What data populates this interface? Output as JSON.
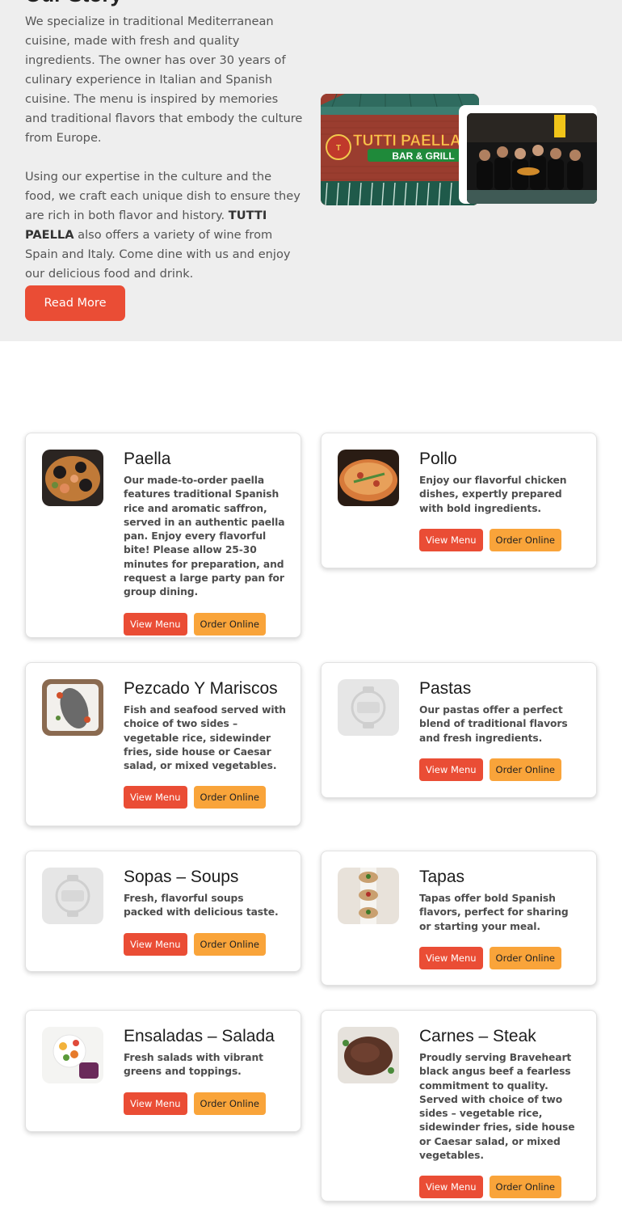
{
  "about": {
    "heading": "Our Story",
    "paragraph1": "We specialize in traditional Mediterranean cuisine, made with fresh and quality ingredients. The owner has over 30 years of culinary experience in Italian and Spanish cuisine. The menu is inspired by memories and traditional flavors that embody the culture from Europe.",
    "paragraph2_before": "Using our expertise in the culture and the food, we craft each unique dish to ensure they are rich in both flavor and history. ",
    "paragraph2_brand": "TUTTI PAELLA",
    "paragraph2_after": " also offers a variety of wine from Spain and Italy. Come dine with us and enjoy our delicious food and drink.",
    "read_more_label": "Read More",
    "sign_main": "TUTTI PAELLA",
    "sign_sub": "BAR & GRILL"
  },
  "menu": {
    "view_menu_label": "View Menu",
    "order_online_label": "Order Online",
    "cards": [
      {
        "title": "Paella",
        "image": "paella-photo",
        "description": "Our made-to-order paella features traditional Spanish rice and aromatic saffron, served in an authentic paella pan. Enjoy every flavorful bite! Please allow 25-30 minutes for preparation, and request a large party pan for group dining."
      },
      {
        "title": "Pollo",
        "image": "chicken-pizza-photo",
        "description": "Enjoy our flavorful chicken dishes, expertly prepared with bold ingredients."
      },
      {
        "title": "Pezcado Y Mariscos",
        "image": "fish-photo",
        "description": "Fish and seafood served with choice of two sides – vegetable rice, sidewinder fries, side house or Caesar salad, or mixed vegetables."
      },
      {
        "title": "Pastas",
        "image": "placeholder-logo",
        "description": "Our pastas offer a perfect blend of traditional flavors and fresh ingredients."
      },
      {
        "title": "Sopas – Soups",
        "image": "placeholder-logo",
        "description": "Fresh, flavorful soups packed with delicious taste."
      },
      {
        "title": "Tapas",
        "image": "tapas-photo",
        "description": "Tapas offer bold Spanish flavors, perfect for sharing or starting your meal."
      },
      {
        "title": "Ensaladas – Salada",
        "image": "salad-photo",
        "description": "Fresh salads with vibrant greens and toppings."
      },
      {
        "title": "Carnes – Steak",
        "image": "steak-photo",
        "description": "Proudly serving Braveheart black angus beef a fearless commitment to quality. Served with choice of two sides – vegetable rice, sidewinder fries, side house or Caesar salad, or mixed vegetables."
      }
    ]
  },
  "colors": {
    "primary": "#ea4d35",
    "secondary": "#f9a43a",
    "section_bg": "#eeeeee"
  }
}
